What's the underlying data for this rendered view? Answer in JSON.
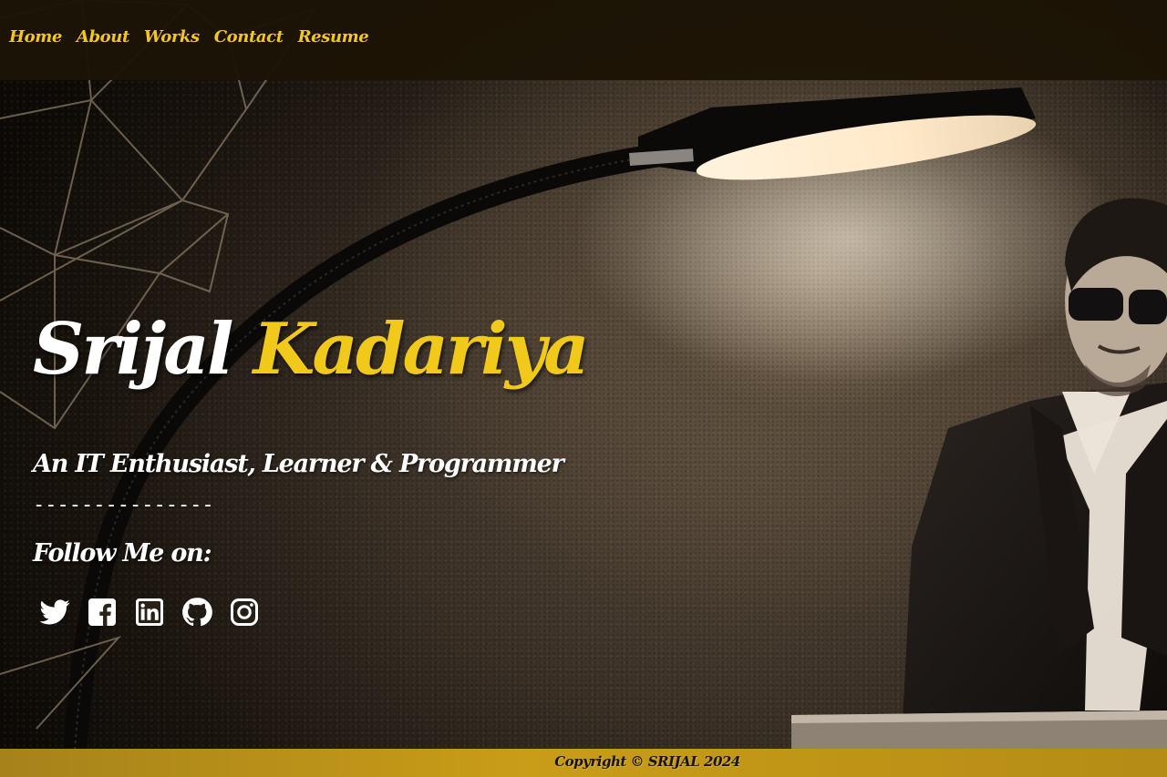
{
  "nav": {
    "items": [
      {
        "label": "Home"
      },
      {
        "label": "About"
      },
      {
        "label": "Works"
      },
      {
        "label": "Contact"
      },
      {
        "label": "Resume"
      }
    ]
  },
  "hero": {
    "first_name": "Srijal",
    "last_name": "Kadariya",
    "tagline": "An IT Enthusiast, Learner & Programmer",
    "divider": "---------------",
    "follow_label": "Follow Me on:"
  },
  "social": [
    "twitter-icon",
    "facebook-icon",
    "linkedin-icon",
    "github-icon",
    "instagram-icon"
  ],
  "footer": {
    "copyright": "Copyright © SRIJAL 2024"
  },
  "colors": {
    "accent": "#f0c91a",
    "nav_bg": "#1c1405",
    "footer_bg": "#c99d18"
  }
}
